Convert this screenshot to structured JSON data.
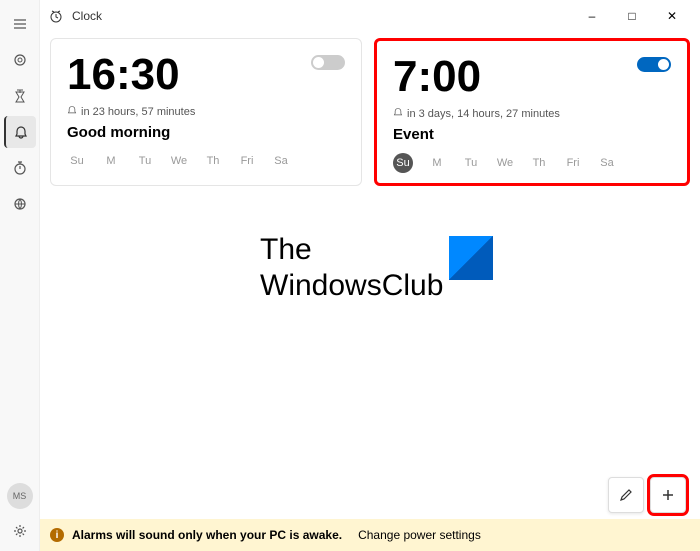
{
  "app": {
    "title": "Clock"
  },
  "window": {
    "minimize": "–",
    "maximize": "□",
    "close": "✕"
  },
  "sidebar": {
    "avatar": "MS"
  },
  "alarms": [
    {
      "time": "16:30",
      "sub": "in 23 hours, 57 minutes",
      "name": "Good morning",
      "on": false,
      "days": [
        "Su",
        "M",
        "Tu",
        "We",
        "Th",
        "Fri",
        "Sa"
      ],
      "active_days": []
    },
    {
      "time": "7:00",
      "sub": "in 3 days, 14 hours, 27 minutes",
      "name": "Event",
      "on": true,
      "days": [
        "Su",
        "M",
        "Tu",
        "We",
        "Th",
        "Fri",
        "Sa"
      ],
      "active_days": [
        "Su"
      ]
    }
  ],
  "watermark": {
    "line1": "The",
    "line2": "WindowsClub"
  },
  "infobar": {
    "text": "Alarms will sound only when your PC is awake.",
    "link": "Change power settings"
  }
}
